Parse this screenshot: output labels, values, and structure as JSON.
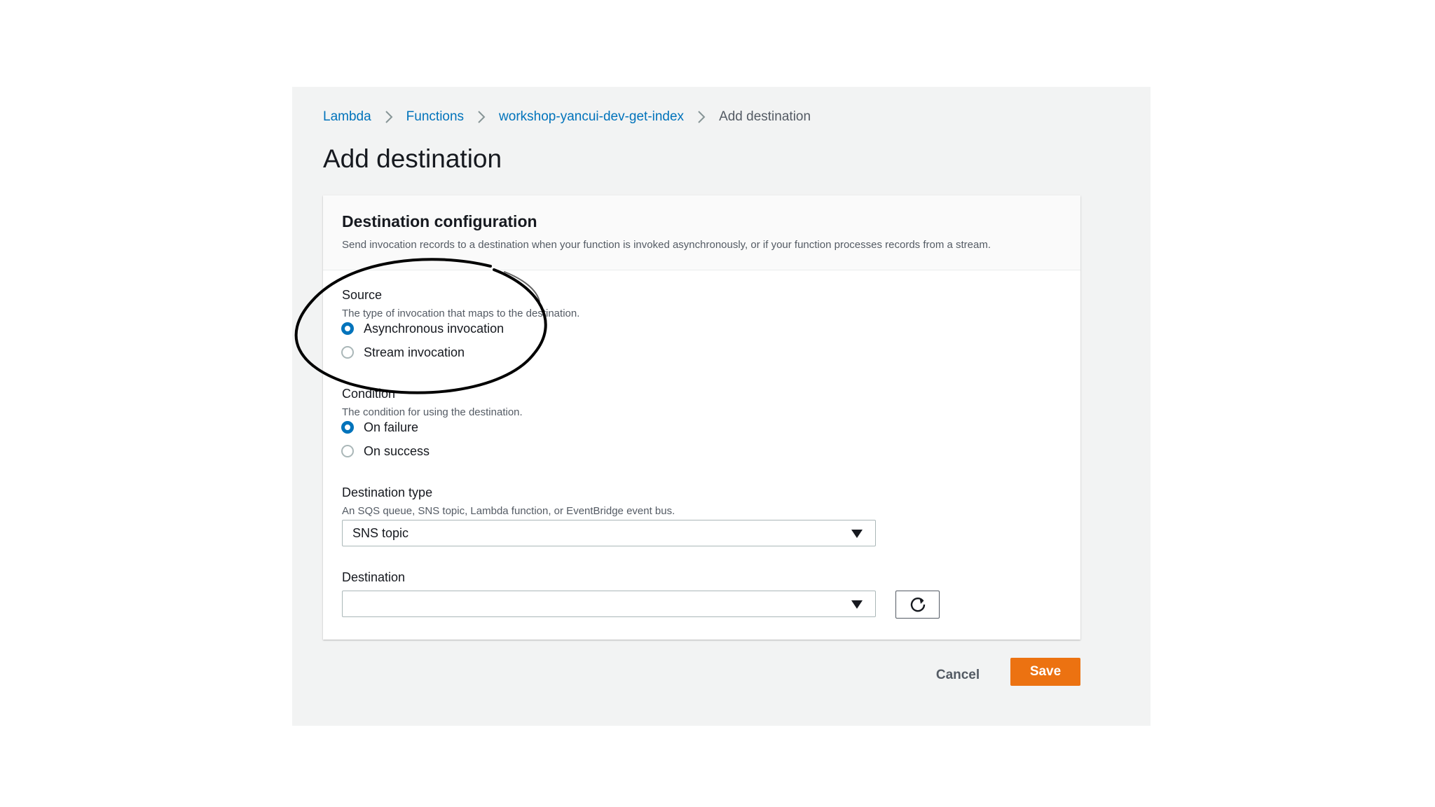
{
  "breadcrumb": {
    "items": [
      "Lambda",
      "Functions",
      "workshop-yancui-dev-get-index"
    ],
    "current": "Add destination"
  },
  "page": {
    "title": "Add destination"
  },
  "panel": {
    "title": "Destination configuration",
    "description": "Send invocation records to a destination when your function is invoked asynchronously, or if your function processes records from a stream."
  },
  "source": {
    "label": "Source",
    "description": "The type of invocation that maps to the destination.",
    "options": [
      "Asynchronous invocation",
      "Stream invocation"
    ],
    "selected": "Asynchronous invocation"
  },
  "condition": {
    "label": "Condition",
    "description": "The condition for using the destination.",
    "options": [
      "On failure",
      "On success"
    ],
    "selected": "On failure"
  },
  "destination_type": {
    "label": "Destination type",
    "description": "An SQS queue, SNS topic, Lambda function, or EventBridge event bus.",
    "value": "SNS topic"
  },
  "destination": {
    "label": "Destination",
    "value": ""
  },
  "actions": {
    "cancel": "Cancel",
    "save": "Save"
  },
  "colors": {
    "accent": "#0073bb",
    "save": "#ec7211",
    "frame": "#f2f3f3"
  },
  "icons": {
    "breadcrumb_separator": "chevron-right-icon",
    "dropdown": "caret-down-icon",
    "refresh": "refresh-icon"
  }
}
